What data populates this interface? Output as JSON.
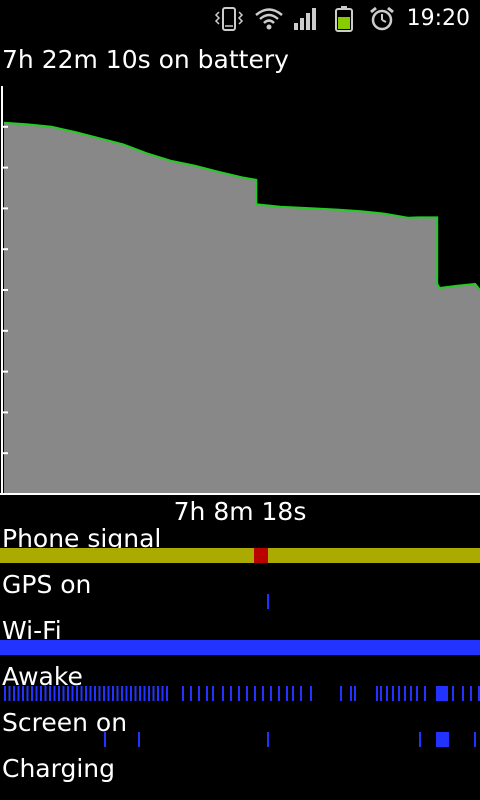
{
  "status_bar": {
    "time": "19:20",
    "icons": [
      "vibrate-icon",
      "wifi-icon",
      "signal-icon",
      "battery-charging-icon",
      "alarm-icon"
    ]
  },
  "battery": {
    "title": "7h 22m 10s on battery",
    "duration_label": "7h 8m 18s"
  },
  "colors": {
    "fill": "#888888",
    "line": "#22cc22",
    "axis": "#ffffff",
    "signal_good": "#aaaa00",
    "signal_bad": "#bb0000",
    "activity": "#2233ff"
  },
  "chart_data": {
    "type": "area",
    "title": "7h 22m 10s on battery",
    "x_label": "7h 8m 18s",
    "x": [
      0,
      0.05,
      0.1,
      0.15,
      0.2,
      0.25,
      0.3,
      0.35,
      0.4,
      0.45,
      0.5,
      0.53,
      0.53,
      0.58,
      0.65,
      0.7,
      0.75,
      0.8,
      0.85,
      0.87,
      0.91,
      0.91,
      0.915,
      0.95,
      0.99,
      1.0
    ],
    "y": [
      91,
      90.6,
      90,
      88.7,
      87.2,
      85.7,
      83.5,
      81.7,
      80.5,
      79,
      77.6,
      77,
      71,
      70.4,
      70,
      69.7,
      69.3,
      68.7,
      67.7,
      67.8,
      67.8,
      51.5,
      50.5,
      51,
      51.5,
      50
    ],
    "ylim": [
      0,
      100
    ],
    "grid": false
  },
  "rows": [
    {
      "label": "Phone signal"
    },
    {
      "label": "GPS on"
    },
    {
      "label": "Wi-Fi"
    },
    {
      "label": "Awake"
    },
    {
      "label": "Screen on"
    },
    {
      "label": "Charging"
    }
  ]
}
